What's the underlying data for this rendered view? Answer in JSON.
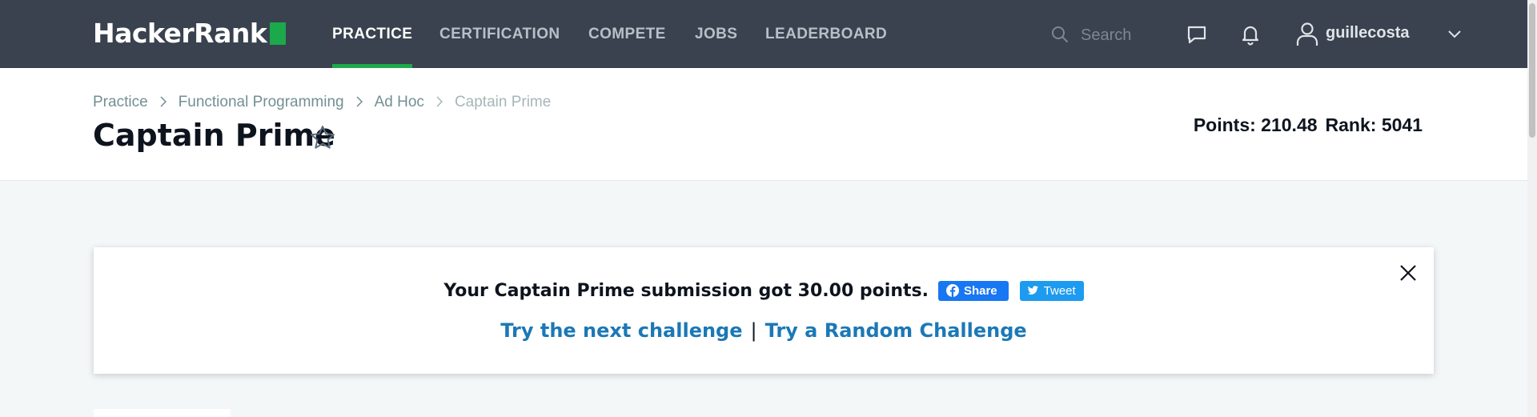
{
  "nav": {
    "logo": "HackerRank",
    "items": [
      {
        "label": "PRACTICE",
        "active": true
      },
      {
        "label": "CERTIFICATION",
        "active": false
      },
      {
        "label": "COMPETE",
        "active": false
      },
      {
        "label": "JOBS",
        "active": false
      },
      {
        "label": "LEADERBOARD",
        "active": false
      }
    ],
    "search_placeholder": "Search",
    "icons": [
      "search-icon",
      "messages-icon",
      "notifications-icon",
      "user-icon",
      "chevron-down-icon"
    ],
    "username": "guillecosta"
  },
  "breadcrumb": [
    "Practice",
    "Functional Programming",
    "Ad Hoc",
    "Captain Prime"
  ],
  "page": {
    "title": "Captain Prime",
    "points": "Points: 210.48",
    "rank": "Rank: 5041"
  },
  "notice": {
    "message": "Your Captain Prime submission got 30.00 points.",
    "share_label": "Share",
    "tweet_label": "Tweet",
    "next_challenge": "Try the next challenge",
    "separator": "|",
    "random_challenge": "Try a Random Challenge"
  },
  "colors": {
    "nav_bg": "#39424e",
    "accent_green": "#1ba94c",
    "link_blue": "#1b78b6",
    "facebook_blue": "#1877f2",
    "twitter_blue": "#1d9bf0",
    "page_bg": "#f3f7f7"
  }
}
